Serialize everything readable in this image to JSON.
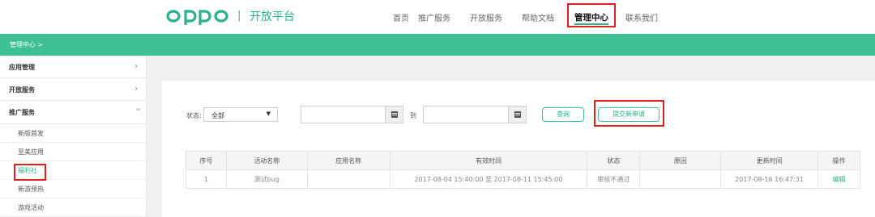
{
  "header": {
    "logo_text": "oppo",
    "separator": "|",
    "platform_name": "开放平台",
    "nav": [
      {
        "label": "首页"
      },
      {
        "label": "推广服务"
      },
      {
        "label": "开放服务"
      },
      {
        "label": "帮助文档"
      },
      {
        "label": "管理中心",
        "active": true
      },
      {
        "label": "联系我们"
      }
    ]
  },
  "breadcrumb": "管理中心 >",
  "sidebar": {
    "groups": [
      {
        "label": "应用管理",
        "chevron": "›"
      },
      {
        "label": "开放服务",
        "chevron": "›"
      },
      {
        "label": "推广服务",
        "chevron": "⌄"
      }
    ],
    "sub_items": [
      {
        "label": "新版首发"
      },
      {
        "label": "至美应用"
      },
      {
        "label": "福利社",
        "active": true
      },
      {
        "label": "新游预热"
      },
      {
        "label": "游戏活动"
      }
    ]
  },
  "filter": {
    "status_label": "状态:",
    "status_value": "全部",
    "to_label": "到",
    "start_date": "",
    "end_date": "",
    "query_button": "查询",
    "submit_button": "提交新申请"
  },
  "table": {
    "headers": [
      "序号",
      "活动名称",
      "应用名称",
      "有效时间",
      "状态",
      "原因",
      "更新时间",
      "操作"
    ],
    "rows": [
      {
        "index": "1",
        "activity_name": "测试bug",
        "app_name": "",
        "valid_time": "2017-08-04 15:40:00 至 2017-08-11 15:45:00",
        "status": "审核不通过",
        "reason": "",
        "updated_at": "2017-08-16 16:47:31",
        "action": "编辑"
      }
    ]
  },
  "colors": {
    "brand_green": "#3ebf94",
    "highlight_red": "#e02020"
  }
}
